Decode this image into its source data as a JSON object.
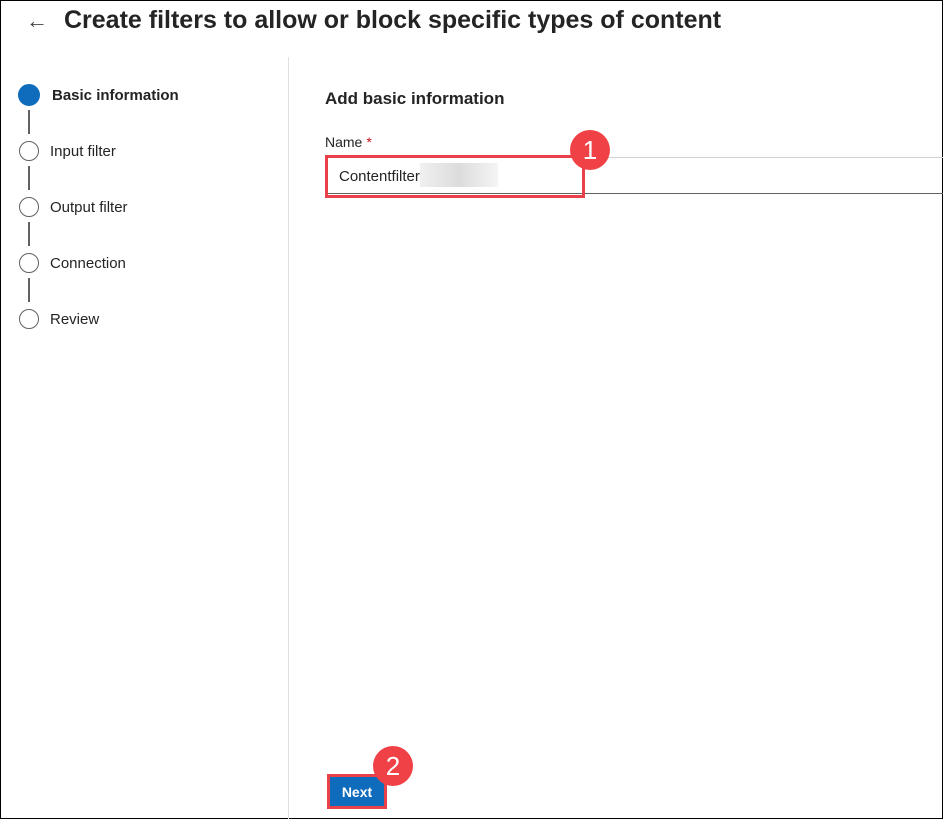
{
  "header": {
    "title": "Create filters to allow or block specific types of content",
    "back_icon": "←"
  },
  "steps": [
    {
      "label": "Basic information",
      "state": "current"
    },
    {
      "label": "Input filter",
      "state": "pending"
    },
    {
      "label": "Output filter",
      "state": "pending"
    },
    {
      "label": "Connection",
      "state": "pending"
    },
    {
      "label": "Review",
      "state": "pending"
    }
  ],
  "form": {
    "heading": "Add basic information",
    "name_label": "Name",
    "required_mark": "*",
    "name_value": "Contentfilter"
  },
  "footer": {
    "next_label": "Next"
  },
  "annotations": [
    "1",
    "2"
  ],
  "colors": {
    "accent": "#0f6cbd",
    "annotation": "#e8414a"
  }
}
